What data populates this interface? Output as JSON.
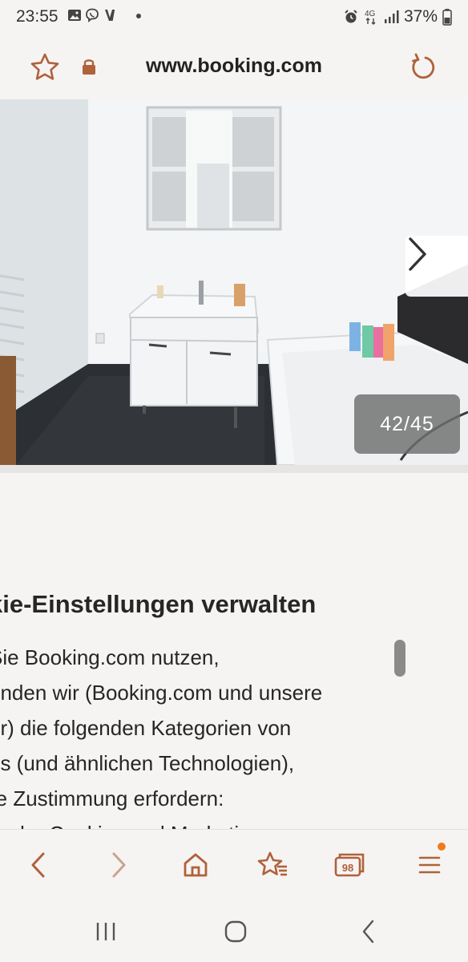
{
  "status_bar": {
    "time": "23:55",
    "battery": "37%",
    "icons_left": [
      "gallery-icon",
      "viber-icon",
      "v-icon"
    ],
    "icons_right": [
      "alarm-icon",
      "4g-icon",
      "signal-icon",
      "battery-icon"
    ]
  },
  "url_bar": {
    "url": "www.booking.com"
  },
  "gallery": {
    "counter": "42/45",
    "current": 42,
    "total": 45
  },
  "cookie": {
    "title": "kie-Einstellungen verwalten",
    "lines": [
      " Sie Booking.com nutzen,",
      "enden wir (Booking.com und unsere",
      "er) die folgenden Kategorien von",
      "es (und ähnlichen Technologien),",
      "re Zustimmung erfordern:",
      "tische Cookies und Marketing"
    ]
  },
  "toolbar": {
    "tabs_count": "98",
    "items": [
      "back-icon",
      "forward-icon",
      "home-icon",
      "bookmarks-icon",
      "tabs-icon",
      "menu-icon"
    ]
  },
  "colors": {
    "accent": "#b0623a",
    "background": "#f6f4f3",
    "menu_badge": "#f07a1a"
  }
}
